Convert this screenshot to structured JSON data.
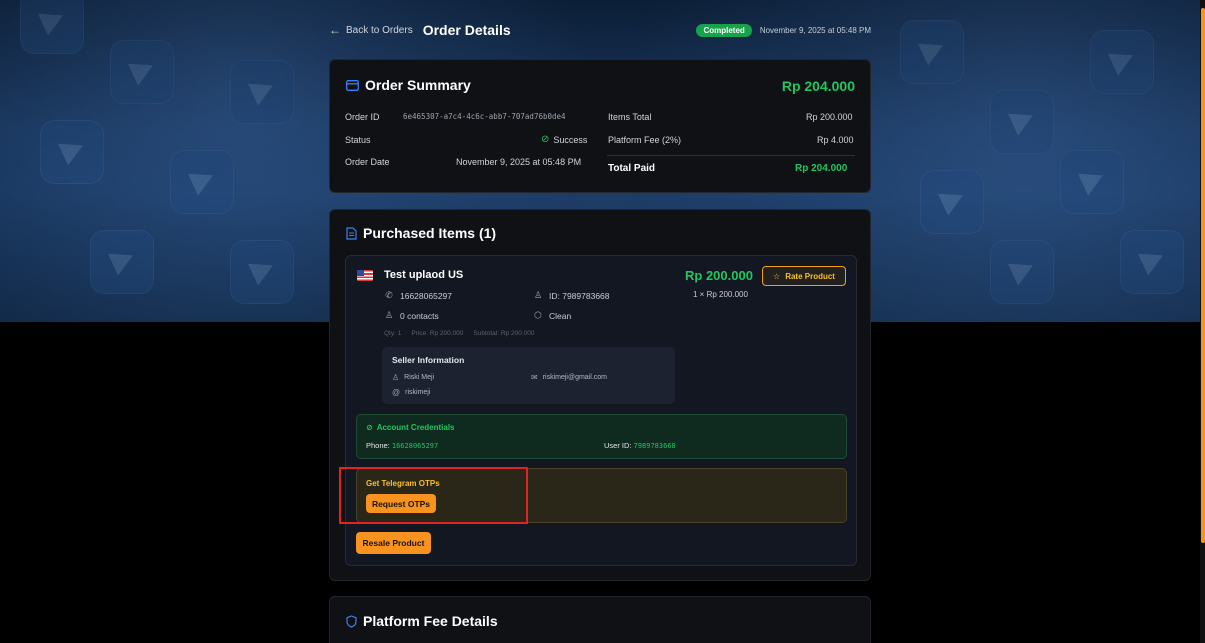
{
  "header": {
    "back_label": "Back to Orders",
    "title": "Order Details",
    "status": "Completed",
    "date": "November 9, 2025 at 05:48 PM"
  },
  "summary": {
    "title": "Order Summary",
    "total": "Rp 204.000",
    "order_id_label": "Order ID",
    "order_id": "6e465307-a7c4-4c6c-abb7-707ad76b0de4",
    "status_label": "Status",
    "status": "Success",
    "order_date_label": "Order Date",
    "order_date": "November 9, 2025 at 05:48 PM",
    "items_total_label": "Items Total",
    "items_total": "Rp 200.000",
    "platform_fee_label": "Platform Fee (2%)",
    "platform_fee": "Rp 4.000",
    "total_paid_label": "Total Paid",
    "total_paid": "Rp 204.000"
  },
  "purchased": {
    "title": "Purchased Items (1)",
    "item": {
      "name": "Test uplaod US",
      "price": "Rp 200.000",
      "qty_line": "1 × Rp 200.000",
      "rate_label": "Rate Product",
      "phone": "16628065297",
      "id": "ID: 7989783668",
      "contacts": "0 contacts",
      "clean": "Clean",
      "qty_small": "Qty: 1",
      "price_small": "Price: Rp 200.000",
      "subtotal_small": "Subtotal: Rp 200.000"
    },
    "seller": {
      "head": "Seller Information",
      "name": "Riski Meji",
      "email": "riskimeji@gmail.com",
      "username": "riskimeji"
    },
    "credentials": {
      "head": "Account Credentials",
      "phone_label": "Phone:",
      "phone": "16628065297",
      "userid_label": "User ID:",
      "userid": "7989783668"
    },
    "otp": {
      "head": "Get Telegram OTPs",
      "button": "Request OTPs"
    },
    "resale_button": "Resale Product"
  },
  "fee": {
    "title": "Platform Fee Details"
  },
  "colors": {
    "accent_green": "#22c55e",
    "accent_orange": "#f7931e",
    "accent_blue": "#3b82f6",
    "highlight_red": "#e02424"
  }
}
